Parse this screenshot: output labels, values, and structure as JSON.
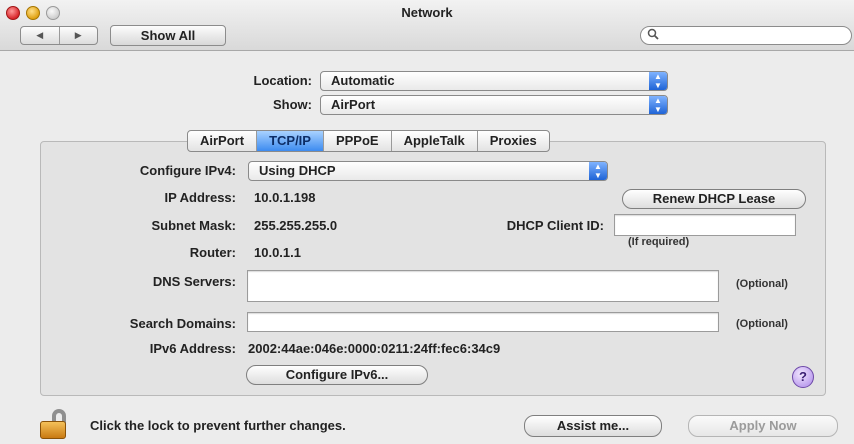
{
  "window": {
    "title": "Network",
    "show_all_label": "Show All",
    "back_arrow": "◀",
    "forward_arrow": "▶",
    "search_icon": "search-icon",
    "search": {
      "value": "",
      "placeholder": ""
    }
  },
  "location": {
    "label": "Location:",
    "value": "Automatic"
  },
  "show": {
    "label": "Show:",
    "value": "AirPort"
  },
  "tabs": [
    {
      "label": "AirPort",
      "active": false
    },
    {
      "label": "TCP/IP",
      "active": true
    },
    {
      "label": "PPPoE",
      "active": false
    },
    {
      "label": "AppleTalk",
      "active": false
    },
    {
      "label": "Proxies",
      "active": false
    }
  ],
  "tcpip": {
    "configure_ipv4": {
      "label": "Configure IPv4:",
      "value": "Using DHCP"
    },
    "ip_address": {
      "label": "IP Address:",
      "value": "10.0.1.198"
    },
    "renew_button": "Renew DHCP Lease",
    "subnet_mask": {
      "label": "Subnet Mask:",
      "value": "255.255.255.0"
    },
    "dhcp_client_id": {
      "label": "DHCP Client ID:",
      "value": "",
      "hint": "(If required)"
    },
    "router": {
      "label": "Router:",
      "value": "10.0.1.1"
    },
    "dns_servers": {
      "label": "DNS Servers:",
      "value": "",
      "hint": "(Optional)"
    },
    "search_domains": {
      "label": "Search Domains:",
      "value": "",
      "hint": "(Optional)"
    },
    "ipv6_address": {
      "label": "IPv6 Address:",
      "value": "2002:44ae:046e:0000:0211:24ff:fec6:34c9"
    },
    "configure_ipv6_button": "Configure IPv6...",
    "help_label": "?"
  },
  "footer": {
    "lock_text": "Click the lock to prevent further changes.",
    "assist_button": "Assist me...",
    "apply_button": "Apply Now"
  },
  "colors": {
    "accent_blue": "#3d8bf0",
    "window_bg": "#ececec",
    "help_purple": "#bfa2ef",
    "lock_gold": "#f4c15a"
  }
}
